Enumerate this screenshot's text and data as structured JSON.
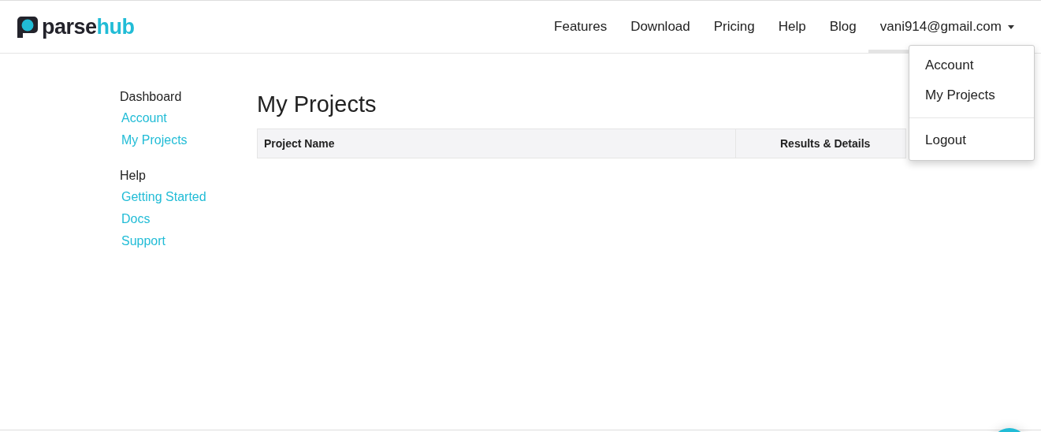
{
  "logo": {
    "part_1": "parse",
    "part_2": "hub"
  },
  "nav": {
    "items": [
      {
        "label": "Features"
      },
      {
        "label": "Download"
      },
      {
        "label": "Pricing"
      },
      {
        "label": "Help"
      },
      {
        "label": "Blog"
      }
    ],
    "user_menu": {
      "label": "vani914@gmail.com",
      "expanded": true,
      "items": [
        {
          "label": "Account",
          "kind": "link"
        },
        {
          "label": "My Projects",
          "kind": "link"
        },
        {
          "kind": "divider"
        },
        {
          "label": "Logout",
          "kind": "link"
        }
      ]
    }
  },
  "sidebar": {
    "groups": [
      {
        "heading": "Dashboard",
        "items": [
          {
            "label": "Account"
          },
          {
            "label": "My Projects"
          }
        ]
      },
      {
        "heading": "Help",
        "items": [
          {
            "label": "Getting Started"
          },
          {
            "label": "Docs"
          },
          {
            "label": "Support"
          }
        ]
      }
    ]
  },
  "main": {
    "title": "My Projects",
    "table": {
      "columns": [
        "Project Name",
        "Results & Details"
      ]
    }
  }
}
